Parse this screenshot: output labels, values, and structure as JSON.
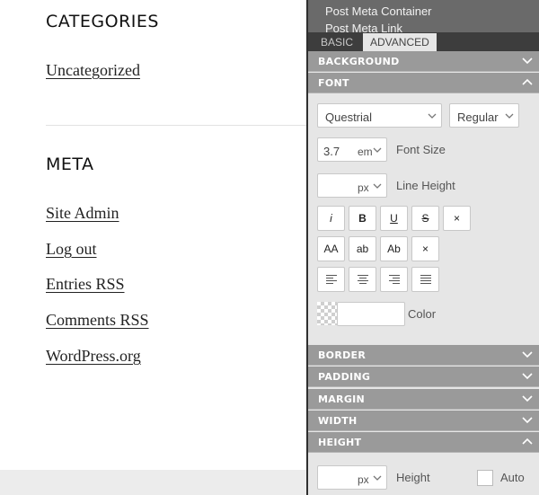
{
  "site": {
    "categories_title": "CATEGORIES",
    "categories": [
      "Uncategorized"
    ],
    "meta_title": "META",
    "meta_links": [
      "Site Admin",
      "Log out",
      "Entries RSS",
      "Comments RSS",
      "WordPress.org"
    ]
  },
  "panel": {
    "breadcrumb": [
      "Post Meta Container",
      "Post Meta Link"
    ],
    "tabs": {
      "basic": "BASIC",
      "advanced": "ADVANCED",
      "active": "advanced"
    },
    "sections": {
      "background": "BACKGROUND",
      "font": "FONT",
      "border": "BORDER",
      "padding": "PADDING",
      "margin": "MARGIN",
      "width": "WIDTH",
      "height": "HEIGHT"
    },
    "font": {
      "family": "Questrial",
      "weight": "Regular",
      "size_value": "3.7",
      "size_unit": "em",
      "size_label": "Font Size",
      "line_height_value": "",
      "line_height_unit": "px",
      "line_height_label": "Line Height",
      "style_buttons": [
        "i",
        "B",
        "U",
        "S",
        "×"
      ],
      "case_buttons": [
        "AA",
        "ab",
        "Ab",
        "×"
      ],
      "align_buttons": [
        "align-left-icon",
        "align-center-icon",
        "align-right-icon",
        "align-justify-icon"
      ],
      "color_value": "",
      "color_label": "Color"
    },
    "height": {
      "value": "",
      "unit": "px",
      "label": "Height",
      "auto_label": "Auto",
      "auto_checked": false
    }
  },
  "colors": {
    "section_header": "#9a9a9a",
    "panel_bg": "#e6e6e6",
    "tabbar": "#3d3d3d",
    "top_bar": "#6a6a6a"
  }
}
